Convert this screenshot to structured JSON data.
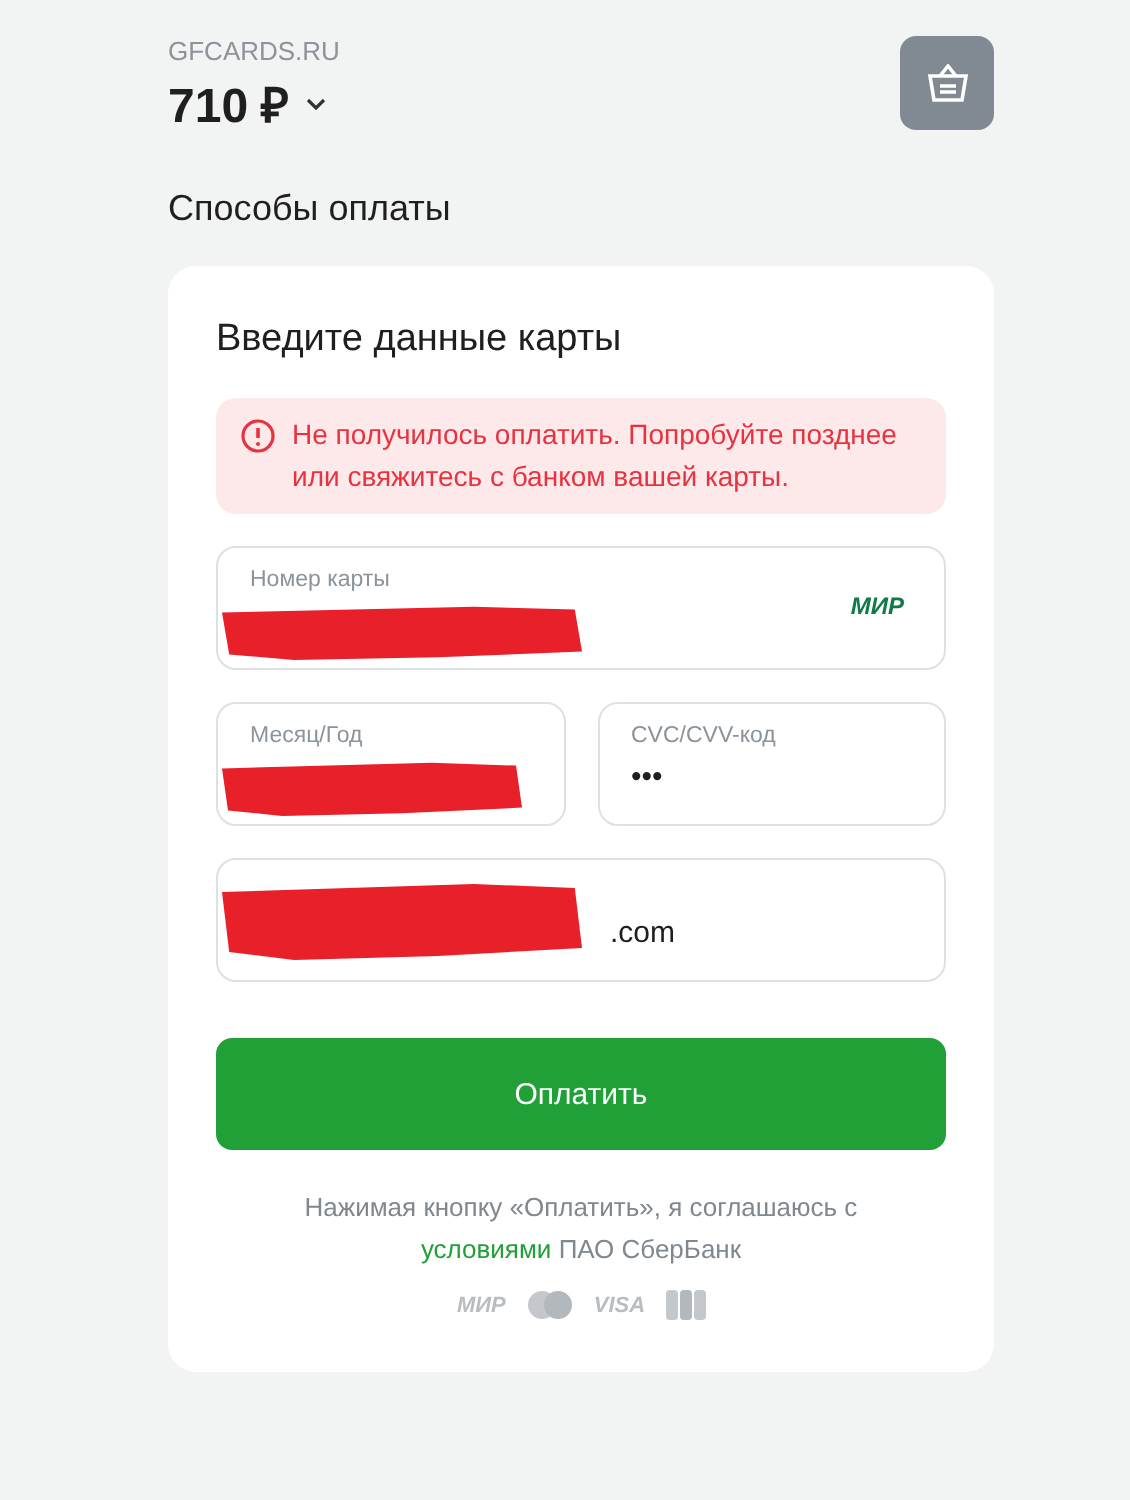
{
  "header": {
    "shop": "GFCARDS.RU",
    "amount": "710 ₽"
  },
  "section_title": "Способы оплаты",
  "card": {
    "title": "Введите данные карты",
    "error": "Не получилось оплатить. Попробуйте позднее или свяжитесь с банком вашей карты.",
    "fields": [
      {
        "kind": "card_number",
        "label": "Номер карты",
        "redacted": true,
        "logo": "МИР"
      },
      {
        "kind": "half",
        "label": "Месяц/Год",
        "redacted": true
      },
      {
        "kind": "half",
        "label": "CVC/CVV-код",
        "value": "•••",
        "redacted": false
      },
      {
        "kind": "full",
        "value": ".com",
        "redacted": true
      }
    ],
    "pay_button": "Оплатить",
    "terms": "Нажимая кнопку «Оплатить», я соглашаюсь с",
    "terms_link": "условиями",
    "terms_end": "ПАО СберБанк",
    "logos": [
      {
        "kind": "text",
        "text": "МИР"
      },
      {
        "kind": "mastercard"
      },
      {
        "kind": "text",
        "text": "VISA"
      },
      {
        "kind": "jcb"
      }
    ]
  }
}
